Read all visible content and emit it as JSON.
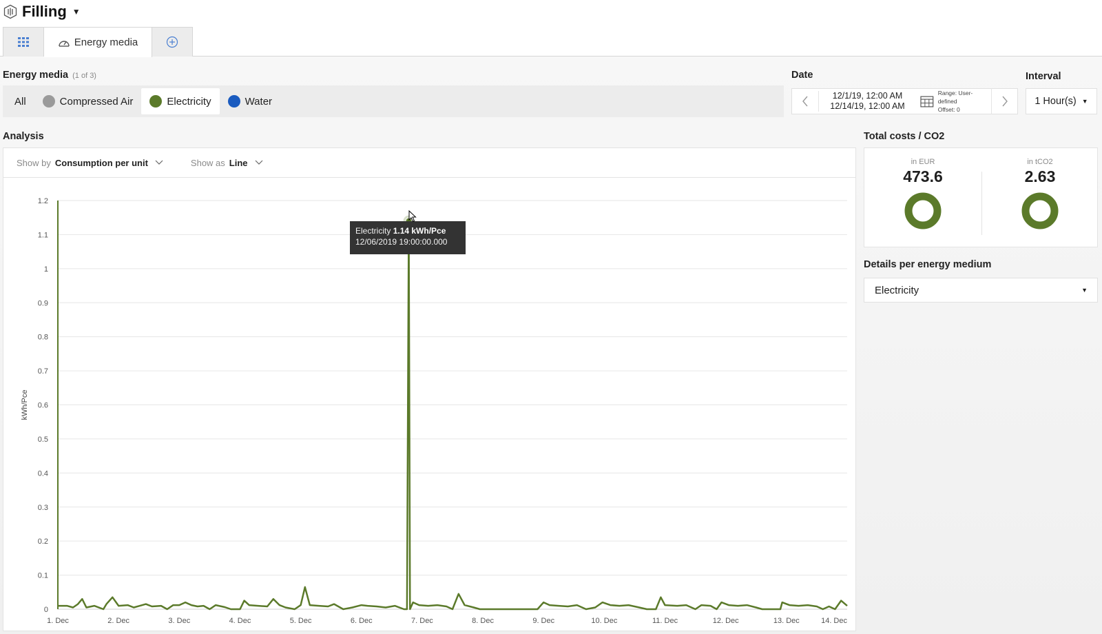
{
  "header": {
    "title": "Filling"
  },
  "tabs": [
    {
      "icon": "grid-icon",
      "label": ""
    },
    {
      "icon": "dashboard-icon",
      "label": "Energy media"
    },
    {
      "icon": "add-circle-icon",
      "label": ""
    }
  ],
  "energy_media": {
    "label": "Energy media",
    "count": "(1 of 3)",
    "items": [
      {
        "label": "All"
      },
      {
        "label": "Compressed Air",
        "color": "#9a9a9a"
      },
      {
        "label": "Electricity",
        "color": "#5b7a2a",
        "selected": true
      },
      {
        "label": "Water",
        "color": "#1a5bbf"
      }
    ]
  },
  "date": {
    "label": "Date",
    "start": "12/1/19, 12:00 AM",
    "end": "12/14/19, 12:00 AM",
    "range": "Range: User-defined",
    "offset": "Offset: 0"
  },
  "interval": {
    "label": "Interval",
    "value": "1 Hour(s)"
  },
  "analysis": {
    "label": "Analysis",
    "show_by_label": "Show by",
    "show_by_value": "Consumption per unit",
    "show_as_label": "Show as",
    "show_as_value": "Line"
  },
  "tooltip": {
    "series": "Electricity",
    "value": "1.14 kWh/Pce",
    "timestamp": "12/06/2019 19:00:00.000"
  },
  "costs": {
    "label": "Total costs / CO2",
    "eur_unit": "in EUR",
    "eur_value": "473.6",
    "co2_unit": "in tCO2",
    "co2_value": "2.63",
    "ring_color": "#5b7a2a"
  },
  "details": {
    "label": "Details per energy medium",
    "value": "Electricity"
  },
  "chart_data": {
    "type": "line",
    "title": "",
    "ylabel": "kWh/Pce",
    "xlabel": "",
    "ylim": [
      0,
      1.2
    ],
    "y_ticks": [
      "0",
      "0.1",
      "0.2",
      "0.3",
      "0.4",
      "0.5",
      "0.6",
      "0.7",
      "0.8",
      "0.9",
      "1",
      "1.1",
      "1.2"
    ],
    "x_ticks": [
      "1. Dec",
      "2. Dec",
      "3. Dec",
      "4. Dec",
      "5. Dec",
      "6. Dec",
      "7. Dec",
      "8. Dec",
      "9. Dec",
      "10. Dec",
      "11. Dec",
      "12. Dec",
      "13. Dec",
      "14. Dec"
    ],
    "x_range_days": [
      0,
      13
    ],
    "grid": true,
    "line_color": "#5b7a2a",
    "series": [
      {
        "name": "Electricity",
        "points": [
          [
            0.0,
            0.01
          ],
          [
            0.15,
            0.01
          ],
          [
            0.25,
            0.005
          ],
          [
            0.33,
            0.015
          ],
          [
            0.4,
            0.03
          ],
          [
            0.47,
            0.005
          ],
          [
            0.6,
            0.01
          ],
          [
            0.75,
            0.0
          ],
          [
            0.8,
            0.015
          ],
          [
            0.9,
            0.035
          ],
          [
            1.0,
            0.01
          ],
          [
            1.15,
            0.012
          ],
          [
            1.25,
            0.005
          ],
          [
            1.35,
            0.01
          ],
          [
            1.45,
            0.015
          ],
          [
            1.55,
            0.008
          ],
          [
            1.7,
            0.01
          ],
          [
            1.8,
            0.0
          ],
          [
            1.9,
            0.012
          ],
          [
            2.0,
            0.012
          ],
          [
            2.1,
            0.02
          ],
          [
            2.2,
            0.012
          ],
          [
            2.3,
            0.008
          ],
          [
            2.4,
            0.01
          ],
          [
            2.5,
            0.0
          ],
          [
            2.6,
            0.012
          ],
          [
            2.75,
            0.006
          ],
          [
            2.85,
            0.0
          ],
          [
            3.0,
            0.0
          ],
          [
            3.07,
            0.025
          ],
          [
            3.15,
            0.012
          ],
          [
            3.3,
            0.01
          ],
          [
            3.45,
            0.008
          ],
          [
            3.55,
            0.03
          ],
          [
            3.65,
            0.012
          ],
          [
            3.75,
            0.005
          ],
          [
            3.9,
            0.0
          ],
          [
            4.0,
            0.012
          ],
          [
            4.07,
            0.065
          ],
          [
            4.15,
            0.012
          ],
          [
            4.3,
            0.01
          ],
          [
            4.45,
            0.008
          ],
          [
            4.55,
            0.015
          ],
          [
            4.7,
            0.0
          ],
          [
            4.85,
            0.005
          ],
          [
            5.0,
            0.012
          ],
          [
            5.1,
            0.01
          ],
          [
            5.25,
            0.008
          ],
          [
            5.4,
            0.005
          ],
          [
            5.55,
            0.01
          ],
          [
            5.7,
            0.0
          ],
          [
            5.75,
            0.0
          ],
          [
            5.78,
            1.14
          ],
          [
            5.8,
            0.0
          ],
          [
            5.85,
            0.02
          ],
          [
            5.95,
            0.012
          ],
          [
            6.1,
            0.01
          ],
          [
            6.25,
            0.012
          ],
          [
            6.4,
            0.008
          ],
          [
            6.5,
            0.0
          ],
          [
            6.6,
            0.045
          ],
          [
            6.7,
            0.012
          ],
          [
            6.85,
            0.005
          ],
          [
            6.95,
            0.0
          ],
          [
            7.1,
            0.0
          ],
          [
            7.2,
            0.0
          ],
          [
            7.35,
            0.0
          ],
          [
            7.5,
            0.0
          ],
          [
            7.6,
            0.0
          ],
          [
            7.75,
            0.0
          ],
          [
            7.9,
            0.0
          ],
          [
            8.0,
            0.02
          ],
          [
            8.1,
            0.012
          ],
          [
            8.25,
            0.01
          ],
          [
            8.4,
            0.008
          ],
          [
            8.55,
            0.012
          ],
          [
            8.7,
            0.0
          ],
          [
            8.85,
            0.005
          ],
          [
            8.97,
            0.02
          ],
          [
            9.1,
            0.012
          ],
          [
            9.25,
            0.01
          ],
          [
            9.4,
            0.012
          ],
          [
            9.55,
            0.006
          ],
          [
            9.7,
            0.0
          ],
          [
            9.85,
            0.0
          ],
          [
            9.93,
            0.035
          ],
          [
            10.0,
            0.012
          ],
          [
            10.2,
            0.01
          ],
          [
            10.35,
            0.012
          ],
          [
            10.5,
            0.0
          ],
          [
            10.6,
            0.012
          ],
          [
            10.75,
            0.01
          ],
          [
            10.85,
            0.0
          ],
          [
            10.93,
            0.02
          ],
          [
            11.05,
            0.012
          ],
          [
            11.2,
            0.01
          ],
          [
            11.35,
            0.012
          ],
          [
            11.5,
            0.005
          ],
          [
            11.6,
            0.0
          ],
          [
            11.7,
            0.0
          ],
          [
            11.9,
            0.0
          ],
          [
            11.93,
            0.02
          ],
          [
            12.05,
            0.012
          ],
          [
            12.2,
            0.01
          ],
          [
            12.35,
            0.012
          ],
          [
            12.5,
            0.008
          ],
          [
            12.6,
            0.0
          ],
          [
            12.7,
            0.008
          ],
          [
            12.8,
            0.0
          ],
          [
            12.9,
            0.025
          ],
          [
            13.0,
            0.01
          ]
        ]
      }
    ],
    "highlight_point": {
      "x": 5.78,
      "y": 1.14
    }
  }
}
